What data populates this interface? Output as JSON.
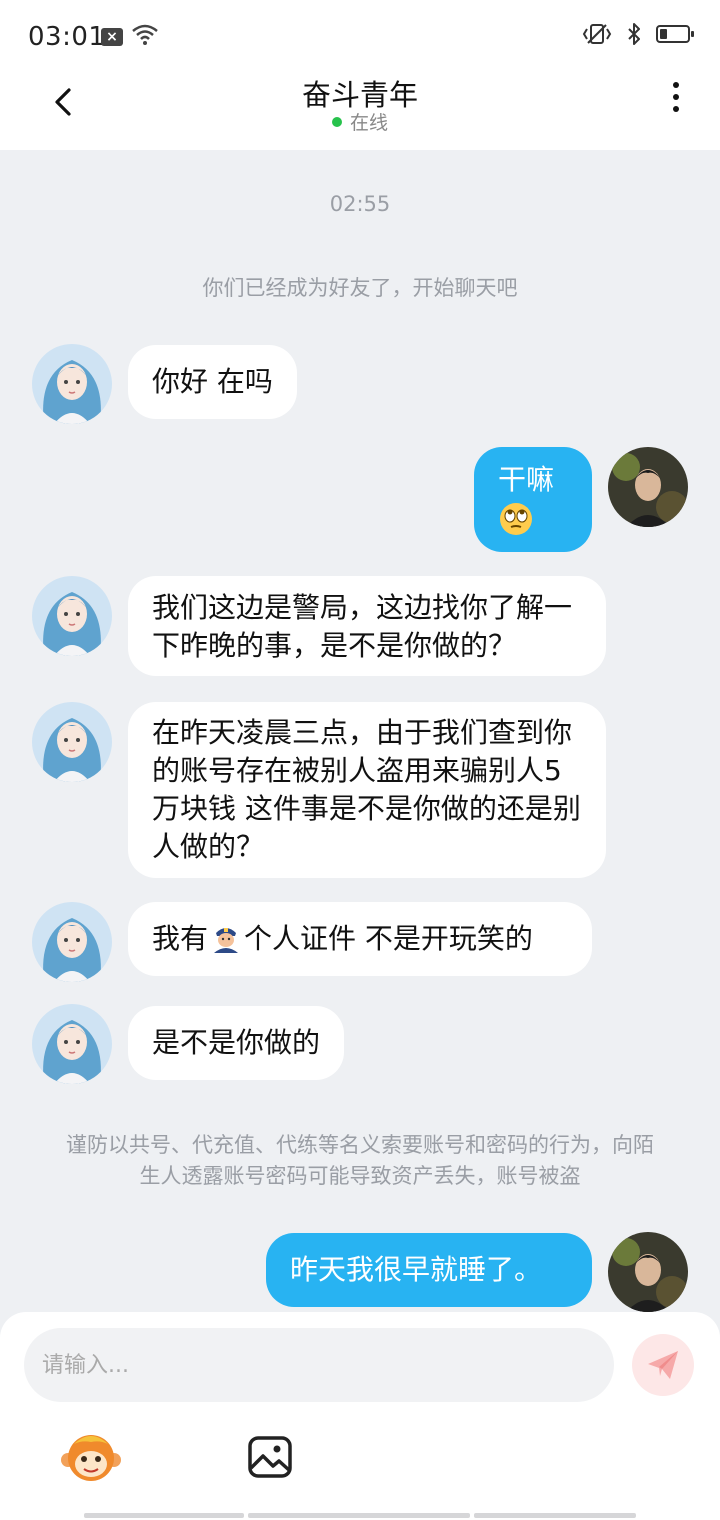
{
  "status_bar": {
    "time": "03:01"
  },
  "header": {
    "title": "奋斗青年",
    "status": "在线"
  },
  "conversation": {
    "timestamp": "02:55",
    "system_notice": "你们已经成为好友了，开始聊天吧",
    "warning_notice": "谨防以共号、代充值、代练等名义索要账号和密码的行为，向陌生人透露账号密码可能导致资产丢失，账号被盗",
    "messages": [
      {
        "sender": "contact",
        "text": "你好 在吗"
      },
      {
        "sender": "me",
        "text": "干嘛",
        "emoji": "face-with-rolling-eyes"
      },
      {
        "sender": "contact",
        "text": "我们这边是警局，这边找你了解一下昨晚的事，是不是你做的？"
      },
      {
        "sender": "contact",
        "text": "在昨天凌晨三点，由于我们查到你的账号存在被别人盗用来骗别人5万块钱 这件事是不是你做的还是别人做的？"
      },
      {
        "sender": "contact",
        "text_before_emoji": "我有",
        "emoji": "police-officer",
        "text_after_emoji": "个人证件 不是开玩笑的"
      },
      {
        "sender": "contact",
        "text": "是不是你做的"
      },
      {
        "sender": "me",
        "text": "昨天我很早就睡了。"
      }
    ]
  },
  "composer": {
    "placeholder": "请输入..."
  },
  "icons": {
    "back": "chevron-left-icon",
    "more": "more-vertical-icon",
    "send": "paper-plane-icon",
    "sticker": "monkey-sticker-icon",
    "image": "image-icon"
  },
  "colors": {
    "outgoing_bubble": "#28b3f2",
    "incoming_bubble": "#ffffff",
    "background": "#eef0f3",
    "online": "#27c24c",
    "send_button": "#fde7e7"
  }
}
